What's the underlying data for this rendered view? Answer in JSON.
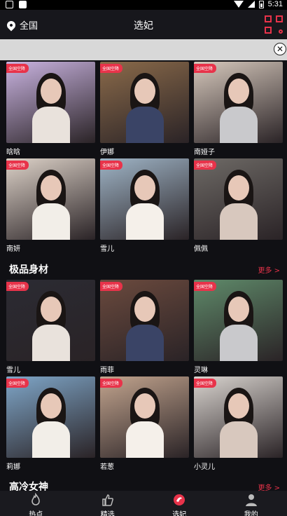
{
  "status_bar": {
    "time": "5:31"
  },
  "header": {
    "location": "全国",
    "title": "选妃"
  },
  "badge_text": "全国空降",
  "top_grid": [
    {
      "name": "晗晗",
      "bg": "#c9b3e0"
    },
    {
      "name": "伊娜",
      "bg": "#8a6a4a"
    },
    {
      "name": "南娅子",
      "bg": "#d6c8bc"
    },
    {
      "name": "南妍",
      "bg": "#ddd2c8"
    },
    {
      "name": "雪儿",
      "bg": "#9fb4c6"
    },
    {
      "name": "佩佩",
      "bg": "#6e6a66"
    }
  ],
  "section1": {
    "title": "极品身材",
    "more": "更多 >"
  },
  "section1_grid": [
    {
      "name": "雪儿",
      "bg": "#2b2b33"
    },
    {
      "name": "雨菲",
      "bg": "#6b4a3e"
    },
    {
      "name": "灵琳",
      "bg": "#5f8a6a"
    },
    {
      "name": "莉娜",
      "bg": "#7fa6c8"
    },
    {
      "name": "若葱",
      "bg": "#c2a48e"
    },
    {
      "name": "小灵儿",
      "bg": "#d9d4cf"
    }
  ],
  "section2": {
    "title": "高冷女神",
    "more": "更多 >"
  },
  "nav": [
    {
      "label": "热点",
      "icon": "flame-icon"
    },
    {
      "label": "精选",
      "icon": "thumbs-up-icon"
    },
    {
      "label": "选妃",
      "icon": "selection-icon"
    },
    {
      "label": "我的",
      "icon": "user-icon"
    }
  ],
  "colors": {
    "accent": "#e8334a",
    "background": "#101014"
  }
}
